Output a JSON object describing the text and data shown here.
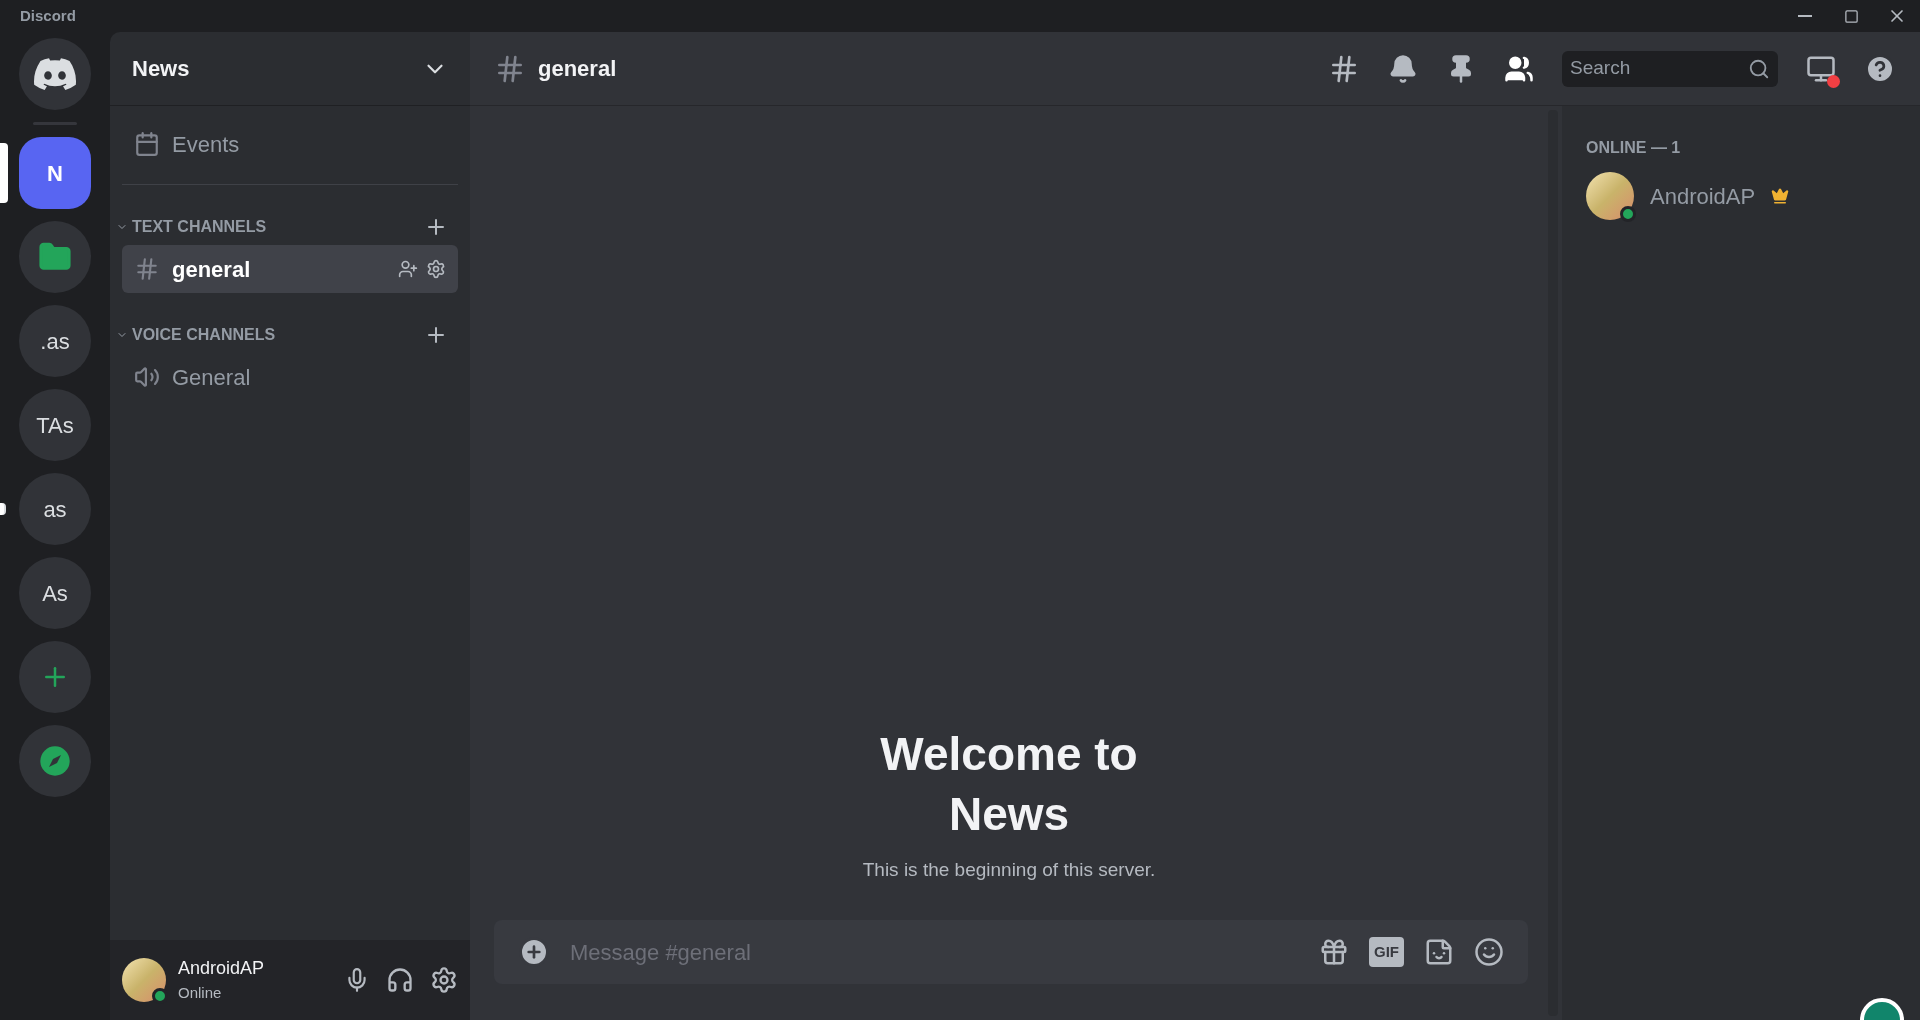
{
  "window": {
    "title": "Discord"
  },
  "servers": [
    {
      "kind": "home",
      "selected": false,
      "unread": false
    },
    {
      "kind": "text",
      "label": "N",
      "selected": true,
      "unread": false
    },
    {
      "kind": "folder",
      "selected": false,
      "unread": false
    },
    {
      "kind": "text",
      "label": ".as",
      "selected": false,
      "unread": false
    },
    {
      "kind": "text",
      "label": "TAs",
      "selected": false,
      "unread": false
    },
    {
      "kind": "text",
      "label": "as",
      "selected": false,
      "unread": true
    },
    {
      "kind": "text",
      "label": "As",
      "selected": false,
      "unread": false
    },
    {
      "kind": "add",
      "selected": false,
      "unread": false
    },
    {
      "kind": "explore",
      "selected": false,
      "unread": false
    }
  ],
  "server_name": "News",
  "events_label": "Events",
  "categories": [
    {
      "name": "TEXT CHANNELS",
      "channels": [
        {
          "kind": "text",
          "name": "general",
          "selected": true
        }
      ]
    },
    {
      "name": "VOICE CHANNELS",
      "channels": [
        {
          "kind": "voice",
          "name": "General",
          "selected": false
        }
      ]
    }
  ],
  "user_panel": {
    "name": "AndroidAP",
    "status": "Online"
  },
  "header": {
    "channel": "general",
    "search_placeholder": "Search"
  },
  "welcome": {
    "title": "Welcome to News",
    "subtitle": "This is the beginning of this server."
  },
  "composer": {
    "placeholder": "Message #general",
    "gif_label": "GIF"
  },
  "members": {
    "heading": "ONLINE — 1",
    "list": [
      {
        "name": "AndroidAP",
        "owner": true
      }
    ]
  }
}
